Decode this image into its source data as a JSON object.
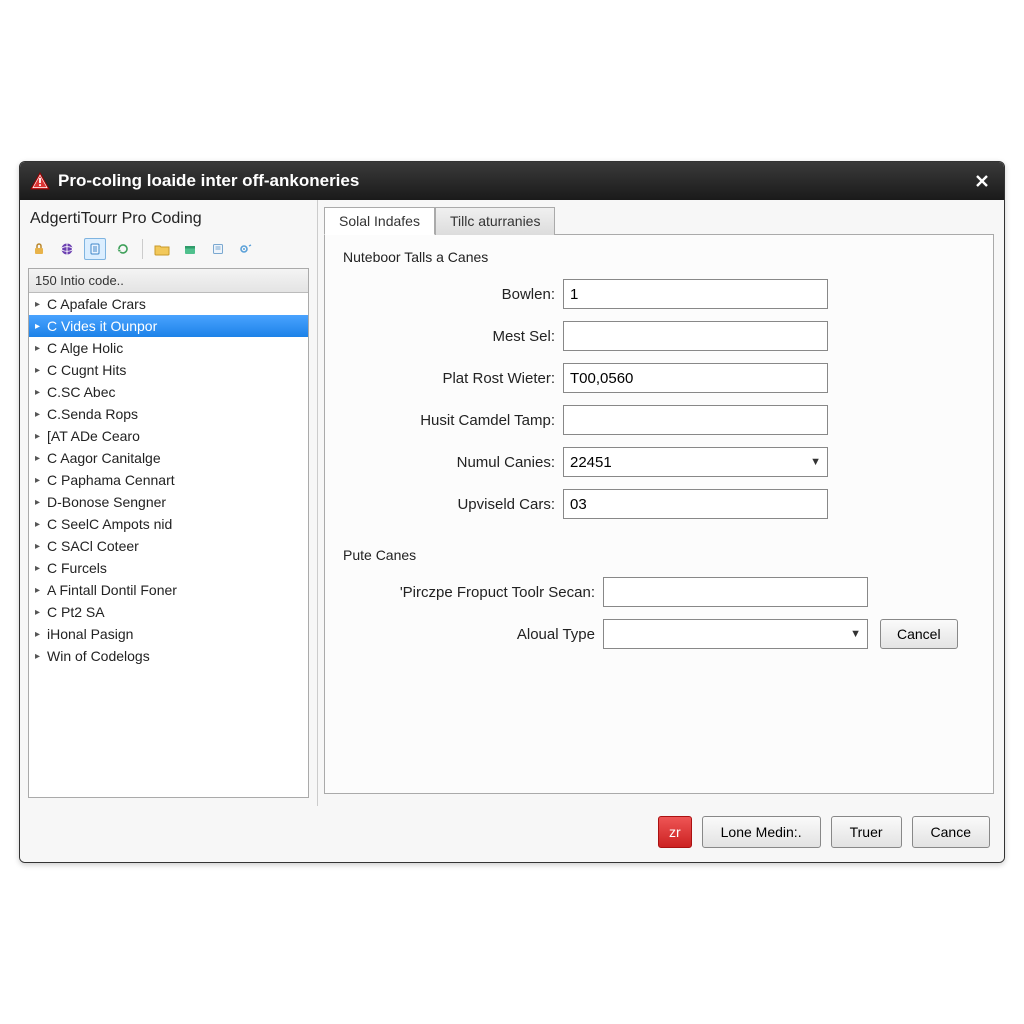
{
  "window": {
    "title": "Pro-coling loaide inter off-ankoneries"
  },
  "sidebar": {
    "heading": "AdgertiTourr Pro Coding",
    "list_header": "150 Intio code..",
    "items": [
      "C Apafale Crars",
      "C Vides it Ounpor",
      "C Alge Holic",
      "C Cugnt Hits",
      "C.SC Abec",
      "C.Senda Rops",
      "[AT ADe Cearo",
      "C Aagor Canitalge",
      "C Paphama Cennart",
      "D-Bonose Sengner",
      "C SeelC Ampots nid",
      "C SACl Coteer",
      "C Furcels",
      "A Fintall Dontil Foner",
      "C Pt2 SA",
      "iHonal Pasign",
      "Win of Codelogs"
    ],
    "selected_index": 1
  },
  "tabs": {
    "labels": [
      "Solal Indafes",
      "Tillc aturranies"
    ],
    "active": 0
  },
  "form": {
    "section1_title": "Nuteboor Talls a Canes",
    "fields": {
      "bowlen": {
        "label": "Bowlen:",
        "value": "1"
      },
      "mest_sel": {
        "label": "Mest Sel:",
        "value": ""
      },
      "plat_rost_wieter": {
        "label": "Plat Rost Wieter:",
        "value": "T00,0560"
      },
      "husit_camdel_tamp": {
        "label": "Husit Camdel Tamp:",
        "value": ""
      },
      "numul_canies": {
        "label": "Numul Canies:",
        "value": "22451"
      },
      "upviseld_cars": {
        "label": "Upviseld Cars:",
        "value": "03"
      }
    },
    "section2_title": "Pute Canes",
    "fields2": {
      "pirczpe_fropuct": {
        "label": "'Pirczpe Fropuct Toolr Secan:",
        "value": ""
      },
      "aloual_type": {
        "label": "Aloual Type",
        "value": ""
      }
    },
    "inline_cancel": "Cancel"
  },
  "footer": {
    "red_icon_label": "zr",
    "lone_medin": "Lone Medin:.",
    "truer": "Truer",
    "cance": "Cance"
  }
}
